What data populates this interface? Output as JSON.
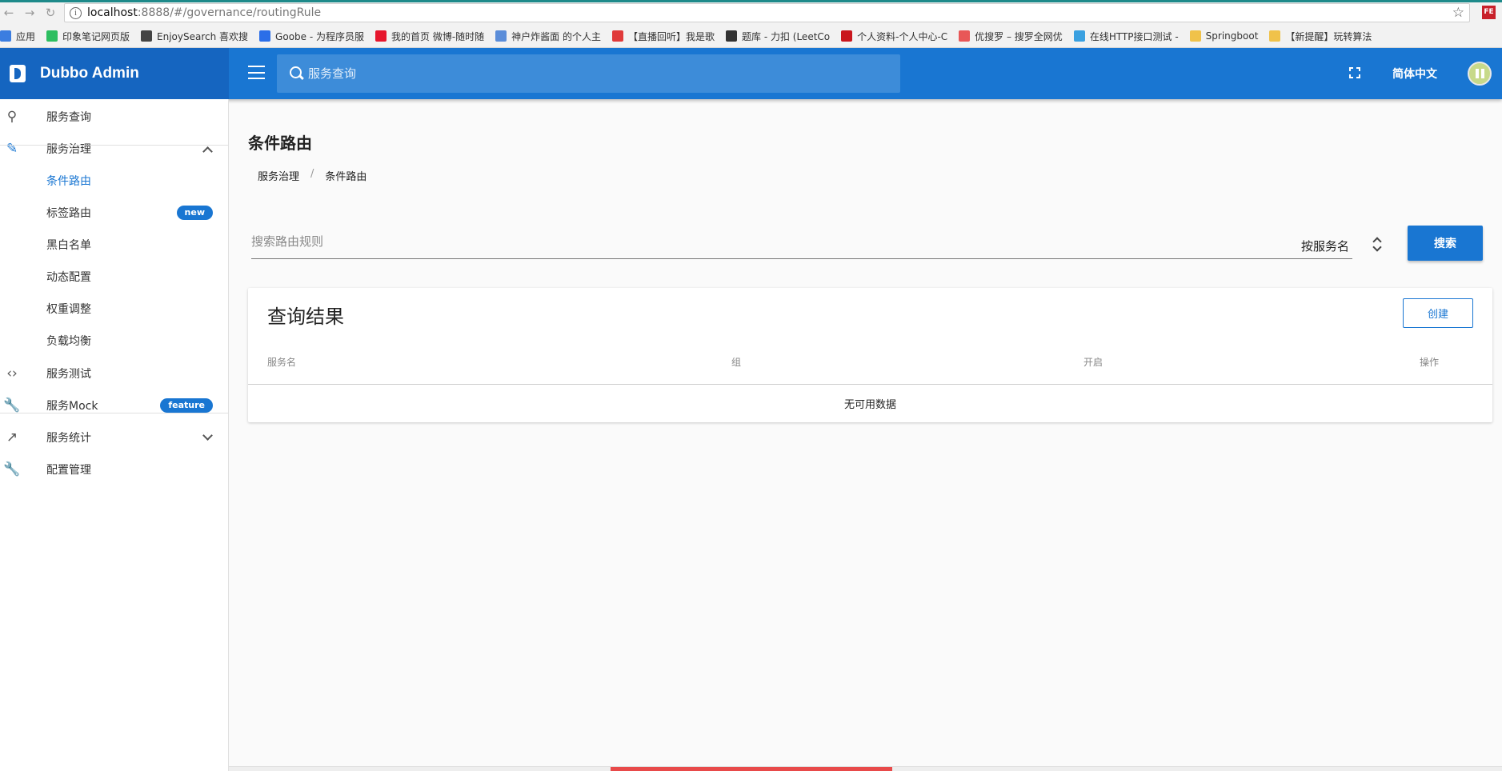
{
  "browser": {
    "url_host": "localhost",
    "url_path": ":8888/#/governance/routingRule",
    "bookmarks": [
      {
        "label": "应用",
        "icon": "apps-grid-icon",
        "color": "#3b7de0"
      },
      {
        "label": "印象笔记网页版",
        "icon": "evernote-icon",
        "color": "#2dbe60"
      },
      {
        "label": "EnjoySearch 喜欢搜",
        "icon": "infinity-icon",
        "color": "#444444"
      },
      {
        "label": "Goobe - 为程序员服",
        "icon": "goobe-icon",
        "color": "#2b6ee8"
      },
      {
        "label": "我的首页 微博-随时随",
        "icon": "weibo-icon",
        "color": "#e6162d"
      },
      {
        "label": "神户炸酱面 的个人主",
        "icon": "globe-icon",
        "color": "#5b8dd9"
      },
      {
        "label": "【直播回听】我是歌",
        "icon": "ting-icon",
        "color": "#e03a3a"
      },
      {
        "label": "题库 - 力扣 (LeetCo",
        "icon": "leetcode-icon",
        "color": "#333333"
      },
      {
        "label": "个人资料-个人中心-C",
        "icon": "csdn-icon",
        "color": "#c9161d"
      },
      {
        "label": "优搜罗 – 搜罗全网优",
        "icon": "yousouluo-icon",
        "color": "#e85757"
      },
      {
        "label": "在线HTTP接口测试 -",
        "icon": "circle-icon",
        "color": "#3aa0e0"
      },
      {
        "label": "Springboot",
        "icon": "folder-icon",
        "color": "#f0c24a"
      },
      {
        "label": "【新提醒】玩转算法",
        "icon": "note-icon",
        "color": "#f0c24a"
      }
    ]
  },
  "app": {
    "brand": "Dubbo Admin",
    "search_placeholder": "服务查询",
    "language": "简体中文"
  },
  "sidebar": {
    "items": [
      {
        "label": "服务查询",
        "icon": "search-icon"
      },
      {
        "label": "服务治理",
        "icon": "pencil-icon"
      },
      {
        "label": "条件路由",
        "icon": ""
      },
      {
        "label": "标签路由",
        "icon": "",
        "badge": "new"
      },
      {
        "label": "黑白名单",
        "icon": ""
      },
      {
        "label": "动态配置",
        "icon": ""
      },
      {
        "label": "权重调整",
        "icon": ""
      },
      {
        "label": "负载均衡",
        "icon": ""
      },
      {
        "label": "服务测试",
        "icon": "code-icon"
      },
      {
        "label": "服务Mock",
        "icon": "wrench-icon",
        "badge": "feature"
      },
      {
        "label": "服务统计",
        "icon": "trending-icon"
      },
      {
        "label": "配置管理",
        "icon": "wrench-icon"
      }
    ]
  },
  "main": {
    "title": "条件路由",
    "breadcrumb": [
      "服务治理",
      "/",
      "条件路由"
    ],
    "filter_placeholder": "搜索路由规则",
    "filter_select": "按服务名",
    "search_button": "搜索",
    "card": {
      "title": "查询结果",
      "create_button": "创建",
      "columns": [
        "服务名",
        "组",
        "开启",
        "操作"
      ],
      "empty_text": "无可用数据"
    }
  },
  "colors": {
    "primary": "#1976d2",
    "brand_dark": "#1565c0"
  }
}
